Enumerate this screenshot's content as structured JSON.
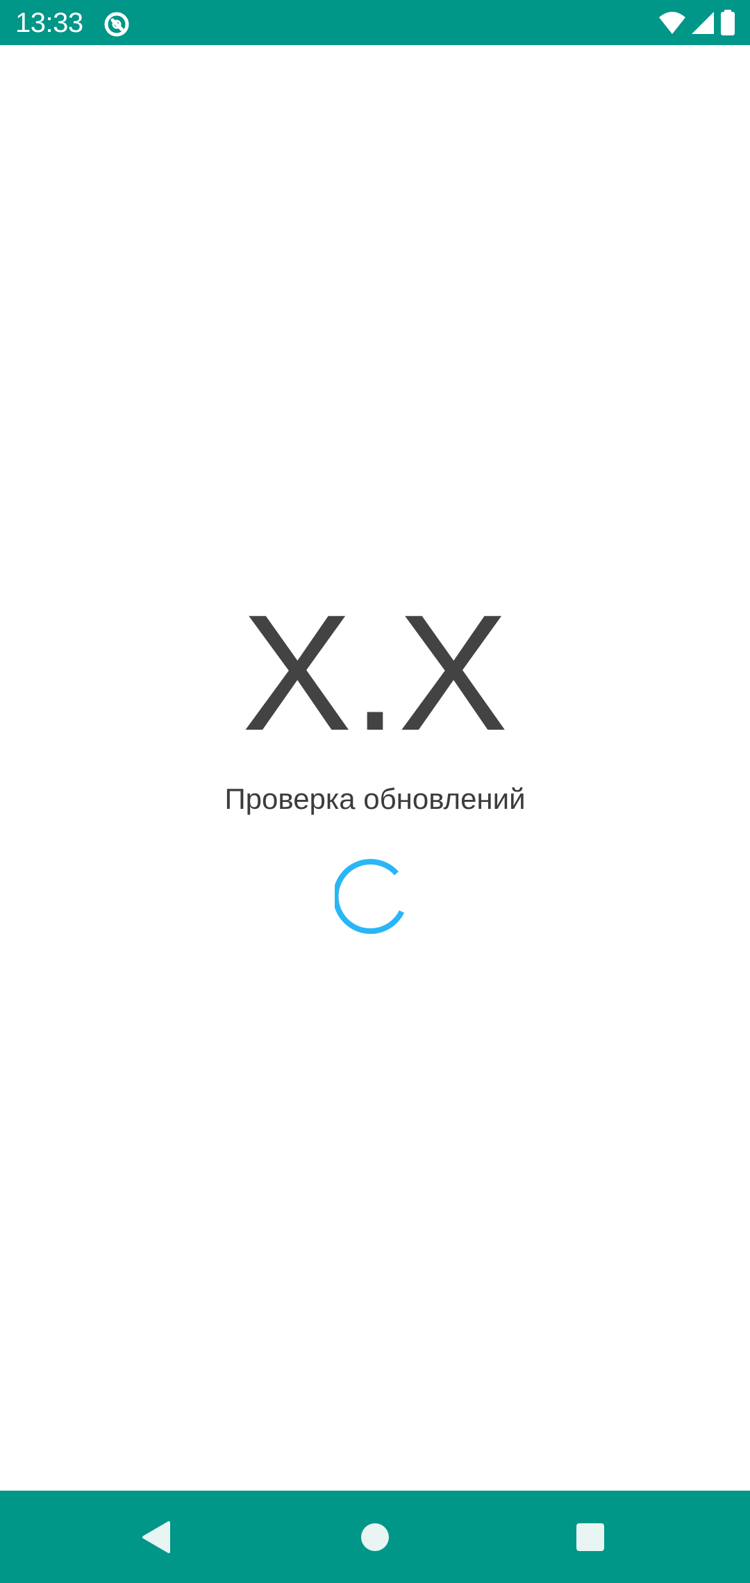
{
  "status_bar": {
    "time": "13:33",
    "icons": [
      "app-notification-icon",
      "wifi-icon",
      "cellular-signal-icon",
      "battery-icon"
    ],
    "background_color": "#009688"
  },
  "main": {
    "version": "X.X",
    "message": "Проверка обновлений",
    "spinner_color": "#29B6F6"
  },
  "nav_bar": {
    "buttons": [
      "back-icon",
      "home-icon",
      "recents-icon"
    ],
    "background_color": "#009688"
  }
}
